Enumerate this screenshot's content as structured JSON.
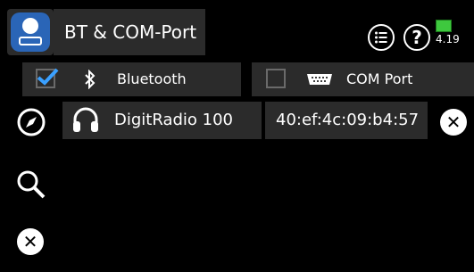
{
  "header": {
    "title": "BT & COM-Port",
    "menu_icon": "list-icon",
    "help_icon": "question-icon",
    "battery": "4.19"
  },
  "tabs": {
    "bluetooth": {
      "label": "Bluetooth",
      "checked": true,
      "icon": "bluetooth-icon"
    },
    "com": {
      "label": "COM Port",
      "checked": false,
      "icon": "serial-port-icon"
    }
  },
  "device_list": [
    {
      "icon": "headphones-icon",
      "name": "DigitRadio 100",
      "mac": "40:ef:4c:09:b4:57",
      "action": "remove-icon"
    }
  ],
  "side_actions": [
    "compass-icon",
    "search-icon",
    "close-circle-icon"
  ],
  "colors": {
    "accent": "#2a65b7",
    "panel": "#2b2b2b",
    "check": "#3aa0ff",
    "battery": "#3ec83e"
  }
}
